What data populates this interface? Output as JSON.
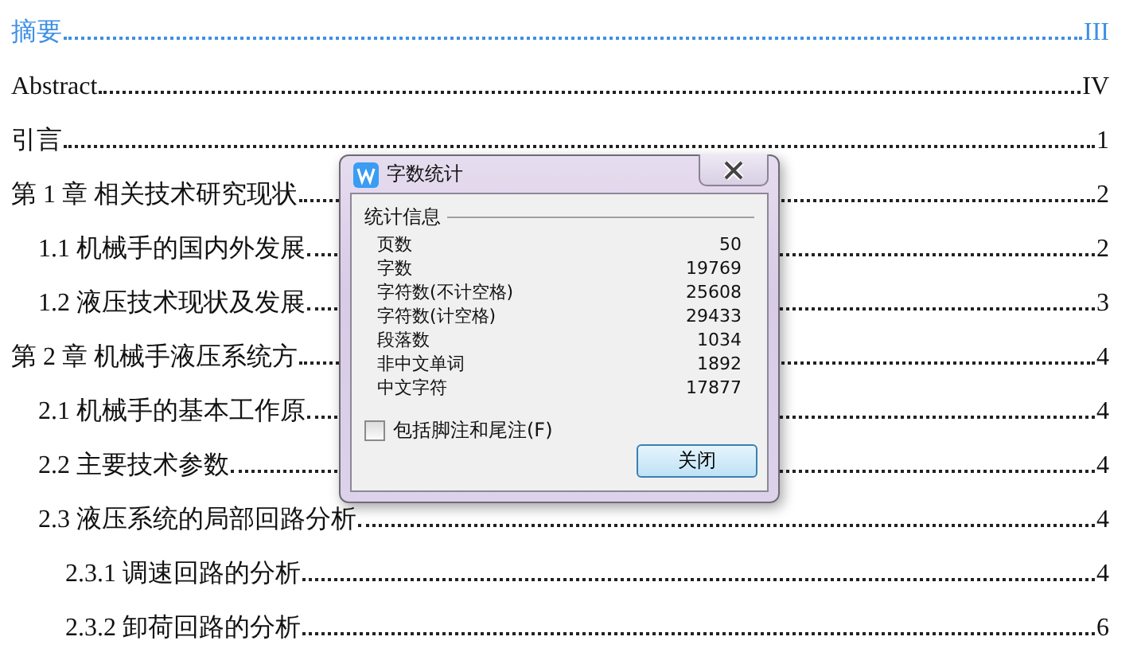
{
  "toc": [
    {
      "link": true,
      "title": "摘要",
      "page": "III"
    },
    {
      "link": false,
      "title": "Abstract",
      "page": "IV"
    },
    {
      "link": false,
      "title": "引言",
      "page": "1"
    },
    {
      "link": false,
      "title": "第 1 章  相关技术研究现状",
      "page": "2",
      "children": [
        {
          "link": false,
          "title": "1.1 机械手的国内外发展",
          "page": "2"
        },
        {
          "link": false,
          "title": "1.2 液压技术现状及发展",
          "page": "3"
        }
      ]
    },
    {
      "link": false,
      "title": "第 2 章  机械手液压系统方",
      "page": "4",
      "children": [
        {
          "link": false,
          "title": "2.1 机械手的基本工作原",
          "page": "4"
        },
        {
          "link": false,
          "title": "2.2 主要技术参数",
          "page": "4"
        },
        {
          "link": false,
          "title": "2.3 液压系统的局部回路分析",
          "page": "4",
          "children": [
            {
              "link": false,
              "title": "2.3.1 调速回路的分析",
              "page": "4"
            },
            {
              "link": false,
              "title": "2.3.2 卸荷回路的分析",
              "page": "6"
            }
          ]
        }
      ]
    }
  ],
  "dialog": {
    "title": "字数统计",
    "group": "统计信息",
    "stats": [
      {
        "label": "页数",
        "value": "50"
      },
      {
        "label": "字数",
        "value": "19769"
      },
      {
        "label": "字符数(不计空格)",
        "value": "25608"
      },
      {
        "label": "字符数(计空格)",
        "value": "29433"
      },
      {
        "label": "段落数",
        "value": "1034"
      },
      {
        "label": "非中文单词",
        "value": "1892"
      },
      {
        "label": "中文字符",
        "value": "17877"
      }
    ],
    "checkbox": {
      "label": "包括脚注和尾注(F)",
      "checked": false
    },
    "button": "关闭"
  }
}
